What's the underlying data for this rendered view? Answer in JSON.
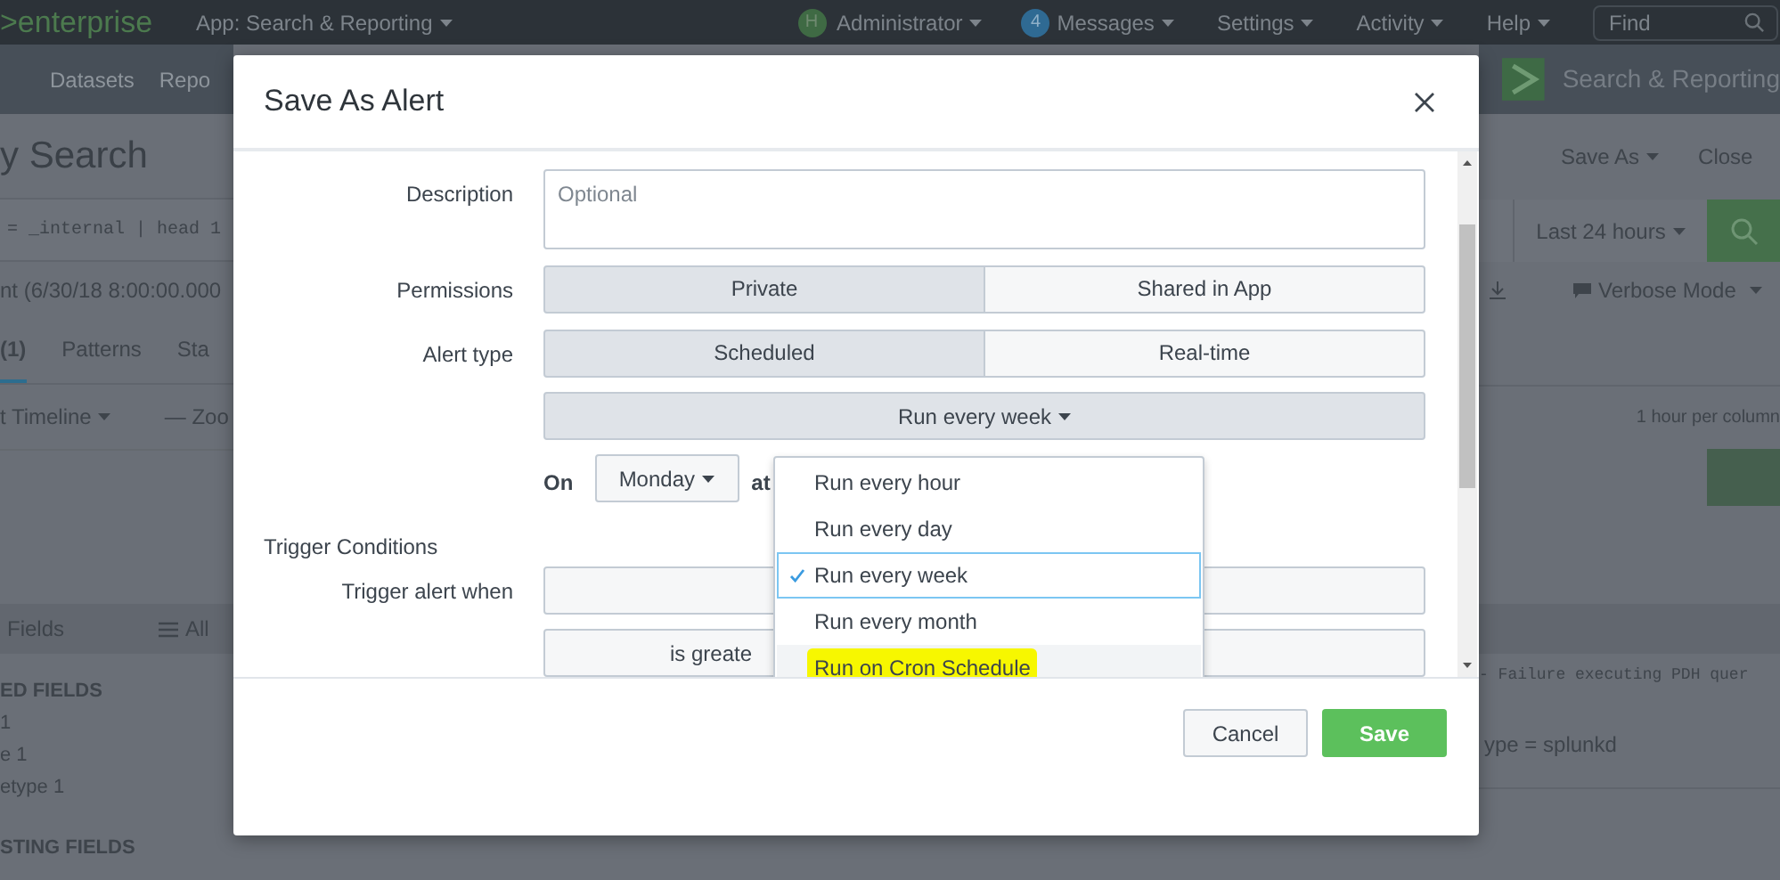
{
  "top_bar": {
    "logo": ">enterprise",
    "app_menu": "App: Search & Reporting",
    "user": {
      "initial": "H",
      "name": "Administrator"
    },
    "messages": {
      "count": "4",
      "label": "Messages"
    },
    "menus": [
      "Settings",
      "Activity",
      "Help"
    ],
    "find": {
      "placeholder": "Find"
    }
  },
  "background": {
    "nav": [
      "Datasets",
      "Repo"
    ],
    "app_name": "Search & Reporting",
    "page_title": "y Search",
    "actions": [
      "Save As",
      "Close"
    ],
    "query": "= _internal | head 1",
    "time_range": "Last 24 hours",
    "event_summary": "nt (6/30/18 8:00:00.000",
    "mode": "Verbose Mode",
    "tabs": [
      {
        "label": "(1)",
        "selected": true
      },
      {
        "label": "Patterns",
        "selected": false
      },
      {
        "label": "Sta",
        "selected": false
      }
    ],
    "timeline_menu": "t Timeline",
    "zoom": "— Zoo",
    "scale": "1 hour per column",
    "fields_title": "Fields",
    "fields_toggle": "All",
    "selected_fields_heading": "ED FIELDS",
    "selected_fields": [
      "1",
      "e 1",
      "etype 1"
    ],
    "interesting_fields_heading": "STING FIELDS",
    "event_text": "- Failure executing PDH quer",
    "event_field": "ype = splunkd"
  },
  "dialog": {
    "title": "Save As Alert",
    "description": {
      "label": "Description",
      "placeholder": "Optional"
    },
    "permissions": {
      "label": "Permissions",
      "options": [
        {
          "label": "Private",
          "selected": true
        },
        {
          "label": "Shared in App",
          "selected": false
        }
      ]
    },
    "alert_type": {
      "label": "Alert type",
      "options": [
        {
          "label": "Scheduled",
          "selected": true
        },
        {
          "label": "Real-time",
          "selected": false
        }
      ]
    },
    "schedule": {
      "value": "Run every week",
      "expanded": true,
      "options": [
        {
          "label": "Run every hour",
          "selected": false,
          "highlighted": false
        },
        {
          "label": "Run every day",
          "selected": false,
          "highlighted": false
        },
        {
          "label": "Run every week",
          "selected": true,
          "highlighted": false
        },
        {
          "label": "Run every month",
          "selected": false,
          "highlighted": false
        },
        {
          "label": "Run on Cron Schedule",
          "selected": false,
          "highlighted": true
        }
      ]
    },
    "day": {
      "label": "On",
      "value": "Monday",
      "after": "at"
    },
    "trigger_section": "Trigger Conditions",
    "trigger": {
      "label": "Trigger alert when",
      "condition": "is greate"
    },
    "buttons": {
      "cancel": "Cancel",
      "save": "Save"
    }
  }
}
